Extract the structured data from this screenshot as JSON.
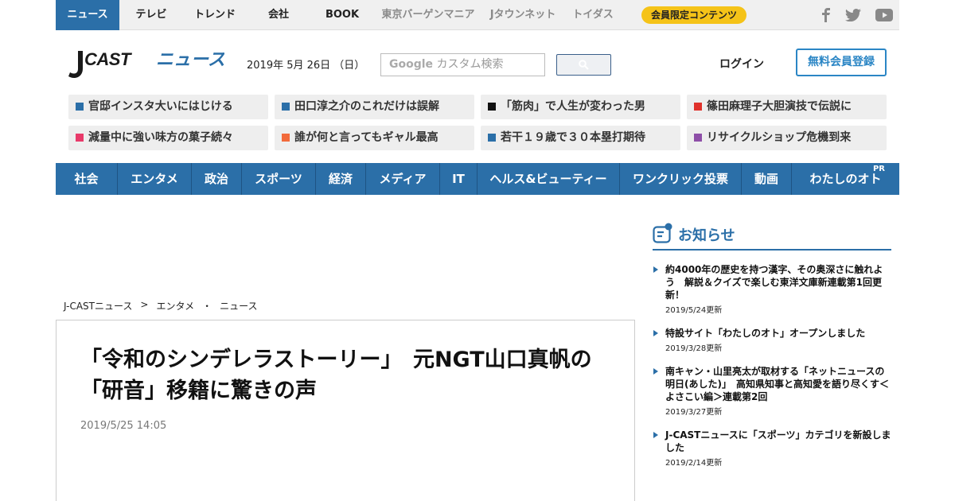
{
  "topnav": {
    "items": [
      {
        "label": "ニュース",
        "state": "active"
      },
      {
        "label": "テレビ",
        "state": "normal"
      },
      {
        "label": "トレンド",
        "state": "normal"
      },
      {
        "label": "会社",
        "state": "normal"
      },
      {
        "label": "BOOK",
        "state": "normal"
      },
      {
        "label": "東京バーゲンマニア",
        "state": "muted"
      },
      {
        "label": "Jタウンネット",
        "state": "muted"
      },
      {
        "label": "トイダス",
        "state": "muted"
      }
    ],
    "premium_label": "会員限定コンテンツ",
    "social": [
      "facebook-icon",
      "twitter-icon",
      "youtube-icon"
    ]
  },
  "header": {
    "logo_text": "J-CAST ニュース",
    "date": "2019年 5月 26日 （日）",
    "search_brand": "Google",
    "search_placeholder": "カスタム検索",
    "login_label": "ログイン",
    "register_label": "無料会員登録"
  },
  "trending": [
    {
      "label": "官邸インスタ大いにはじける",
      "color": "#2b6fa8"
    },
    {
      "label": "田口淳之介のこれだけは誤解",
      "color": "#2b6fa8"
    },
    {
      "label": "「筋肉」で人生が変わった男",
      "color": "#111111"
    },
    {
      "label": "篠田麻理子大胆演技で伝説に",
      "color": "#e0312b"
    },
    {
      "label": "減量中に強い味方の菓子続々",
      "color": "#e83a6a"
    },
    {
      "label": "誰が何と言ってもギャル最高",
      "color": "#f26a3b"
    },
    {
      "label": "若干１９歳で３０本塁打期待",
      "color": "#2b6fa8"
    },
    {
      "label": "リサイクルショップ危機到来",
      "color": "#8e4fa8"
    }
  ],
  "catnav": {
    "items": [
      "社会",
      "エンタメ",
      "政治",
      "スポーツ",
      "経済",
      "メディア",
      "IT",
      "ヘルス&ビューティー",
      "ワンクリック投票",
      "動画",
      "わたしのオト"
    ],
    "pr_badge": "PR"
  },
  "breadcrumb": [
    "J-CASTニュース",
    ">",
    "エンタメ",
    "・",
    "ニュース"
  ],
  "article": {
    "title": "「令和のシンデレラストーリー」　元NGT山口真帆の「研音」移籍に驚きの声",
    "timestamp": "2019/5/25 14:05"
  },
  "sidebar": {
    "heading": "お知らせ",
    "items": [
      {
        "title": "約4000年の歴史を持つ漢字、その奥深さに触れよう　解説＆クイズで楽しむ東洋文庫新連載第1回更新！",
        "date": "2019/5/24更新"
      },
      {
        "title": "特設サイト「わたしのオト」オープンしました",
        "date": "2019/3/28更新"
      },
      {
        "title": "南キャン・山里亮太が取材する「ネットニュースの明日(あした)」　高知県知事と高知愛を語り尽くす＜よさこい編＞連載第2回",
        "date": "2019/3/27更新"
      },
      {
        "title": "J-CASTニュースに「スポーツ」カテゴリを新設しました",
        "date": "2019/2/14更新"
      }
    ]
  }
}
